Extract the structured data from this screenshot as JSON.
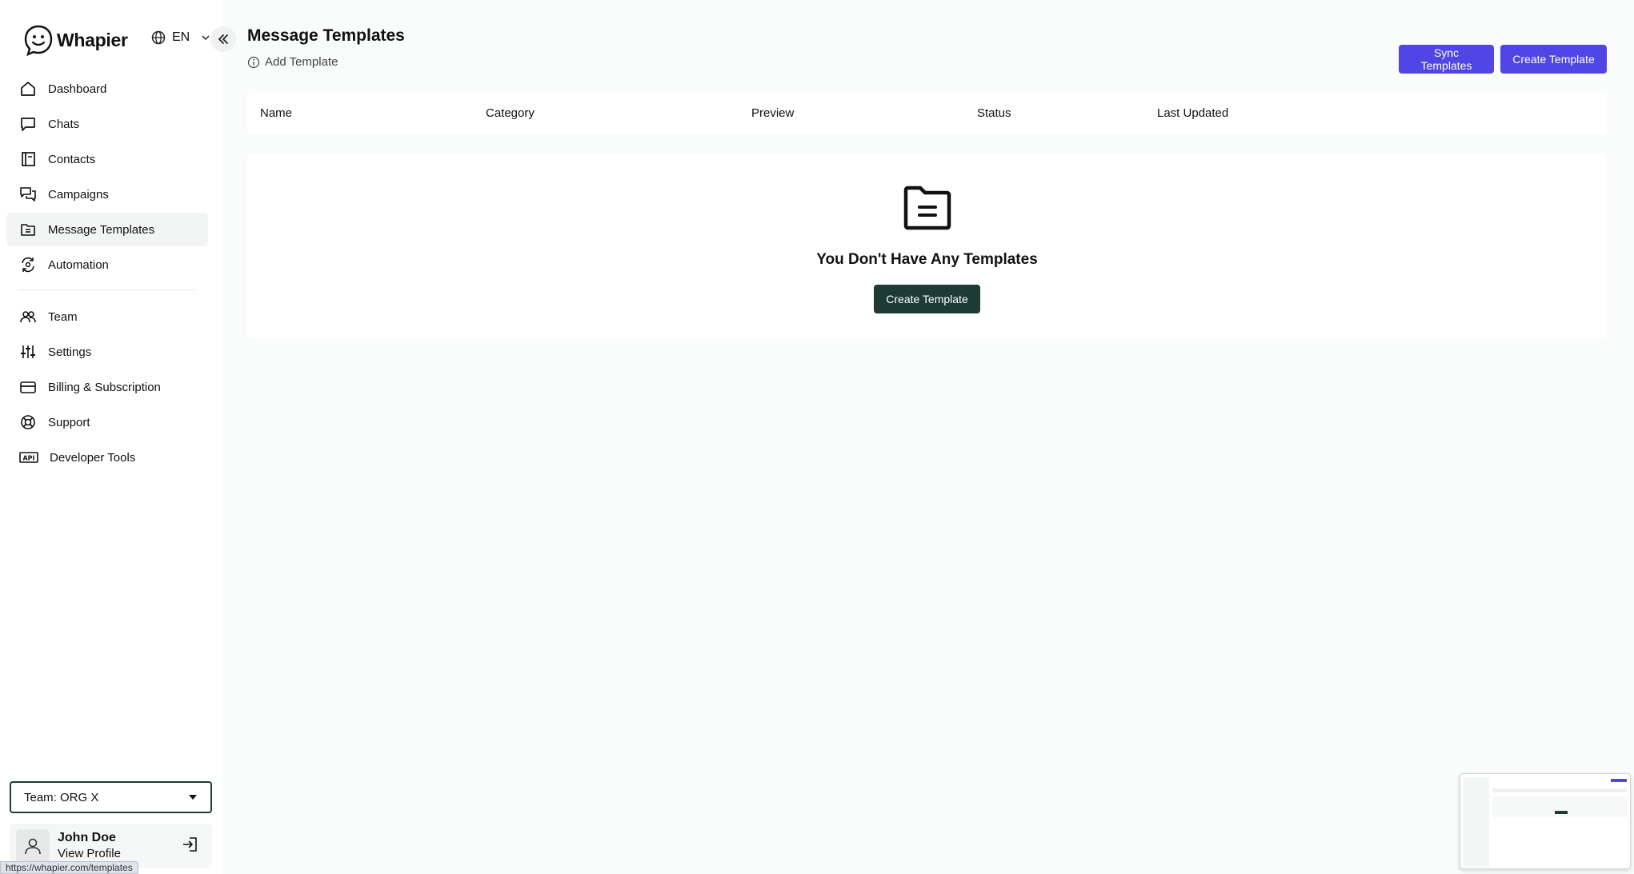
{
  "app": {
    "name": "Whapier",
    "language": "EN"
  },
  "sidebar": {
    "items": [
      {
        "label": "Dashboard",
        "icon": "home-icon"
      },
      {
        "label": "Chats",
        "icon": "chat-icon"
      },
      {
        "label": "Contacts",
        "icon": "contacts-book-icon"
      },
      {
        "label": "Campaigns",
        "icon": "campaigns-icon"
      },
      {
        "label": "Message Templates",
        "icon": "templates-icon",
        "active": true
      },
      {
        "label": "Automation",
        "icon": "automation-icon"
      },
      {
        "label": "Team",
        "icon": "team-icon"
      },
      {
        "label": "Settings",
        "icon": "sliders-icon"
      },
      {
        "label": "Billing & Subscription",
        "icon": "credit-card-icon"
      },
      {
        "label": "Support",
        "icon": "lifebuoy-icon"
      },
      {
        "label": "Developer Tools",
        "icon": "api-icon"
      }
    ],
    "team_select": "Team: ORG X",
    "profile": {
      "name": "John Doe",
      "link": "View Profile"
    }
  },
  "main": {
    "title": "Message Templates",
    "add_template": "Add Template",
    "sync_button": "Sync Templates",
    "create_button": "Create Template",
    "columns": [
      "Name",
      "Category",
      "Preview",
      "Status",
      "Last Updated"
    ],
    "empty": {
      "title": "You Don't Have Any Templates",
      "button": "Create Template"
    }
  },
  "status_url": "https://whapier.com/templates",
  "colors": {
    "primary": "#4f46e5",
    "dark": "#1e3a34",
    "background": "#fafbfb"
  }
}
